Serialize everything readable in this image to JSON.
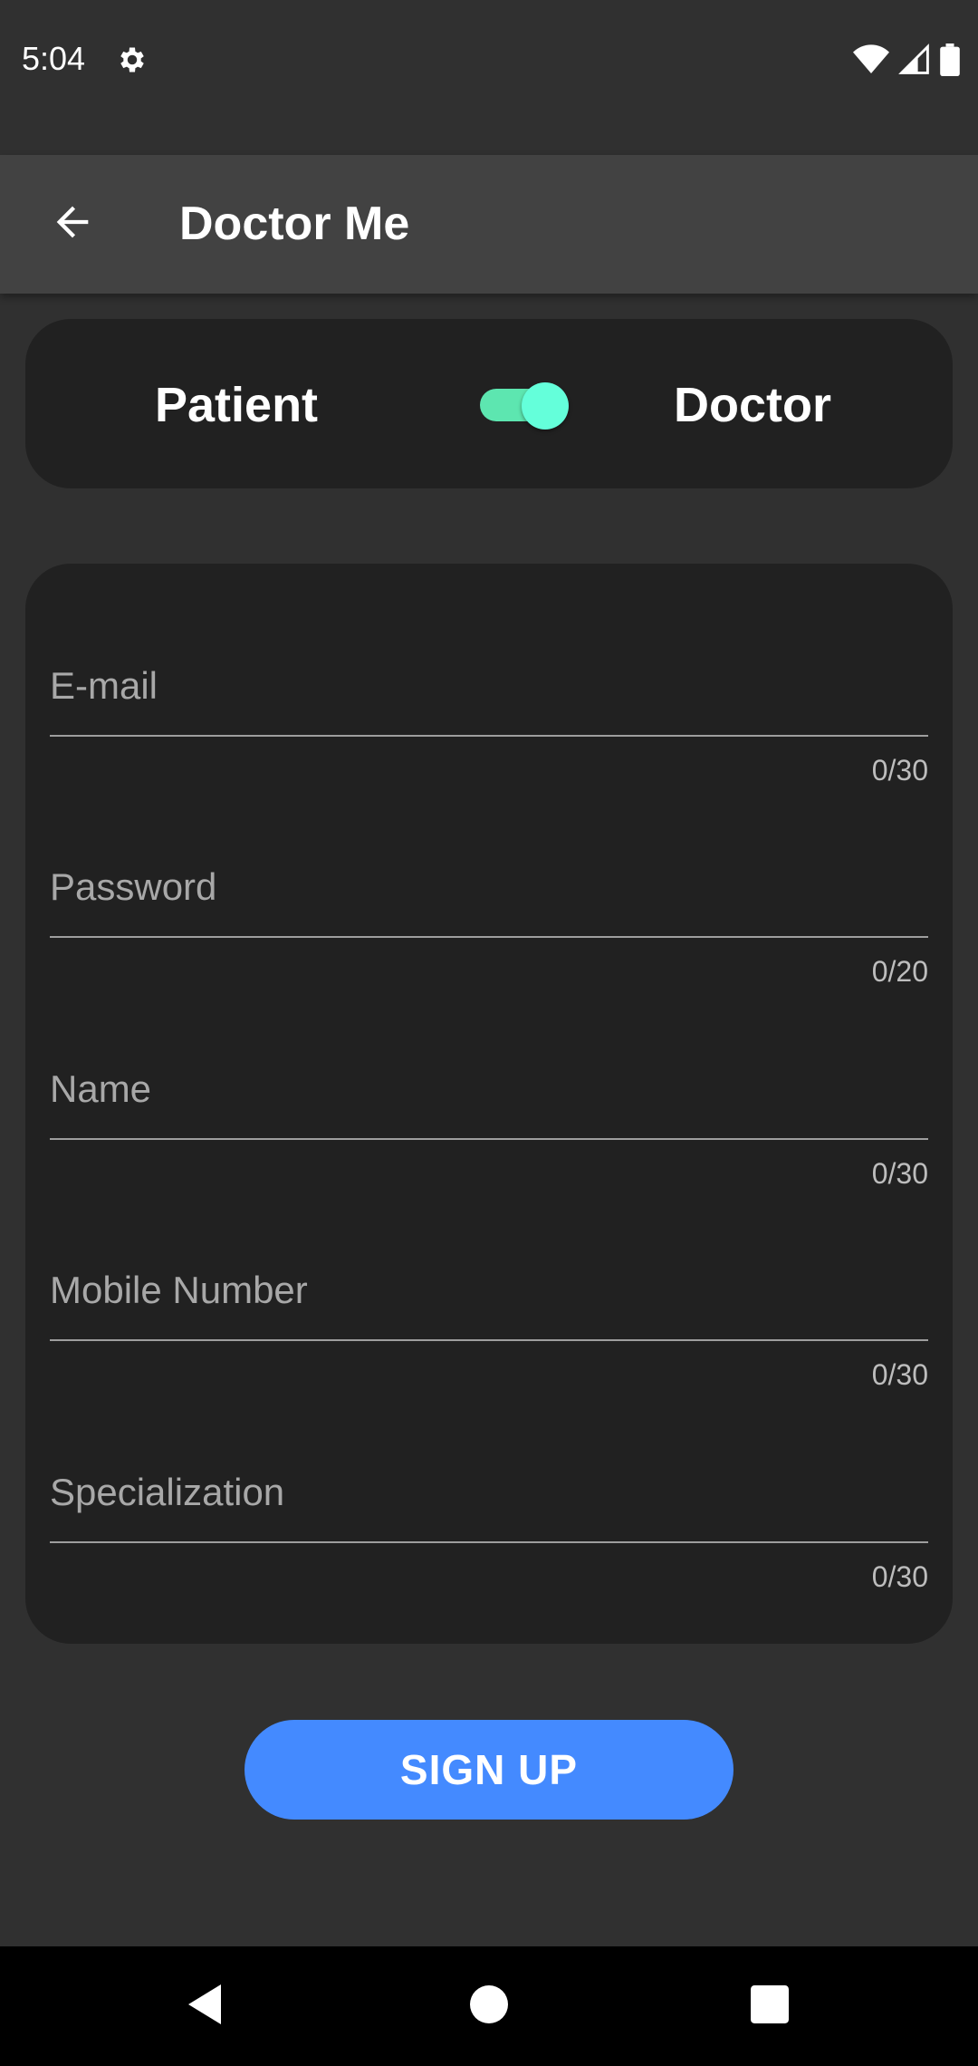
{
  "status_bar": {
    "time": "5:04",
    "icons": [
      "settings-gear-icon",
      "wifi-icon",
      "signal-icon",
      "battery-icon"
    ]
  },
  "app_bar": {
    "title": "Doctor Me",
    "back_icon": "arrow-left-icon"
  },
  "role_toggle": {
    "left_label": "Patient",
    "right_label": "Doctor",
    "state": "on",
    "accent_color": "#64ffda"
  },
  "form": {
    "fields": [
      {
        "placeholder": "E-mail",
        "value": "",
        "counter": "0/30"
      },
      {
        "placeholder": "Password",
        "value": "",
        "counter": "0/20"
      },
      {
        "placeholder": "Name",
        "value": "",
        "counter": "0/30"
      },
      {
        "placeholder": "Mobile Number",
        "value": "",
        "counter": "0/30"
      },
      {
        "placeholder": "Specialization",
        "value": "",
        "counter": "0/30"
      }
    ]
  },
  "signup_button": {
    "label": "SIGN UP",
    "color": "#448aff"
  },
  "nav_bar": {
    "icons": [
      "nav-back-icon",
      "nav-home-icon",
      "nav-recents-icon"
    ]
  }
}
